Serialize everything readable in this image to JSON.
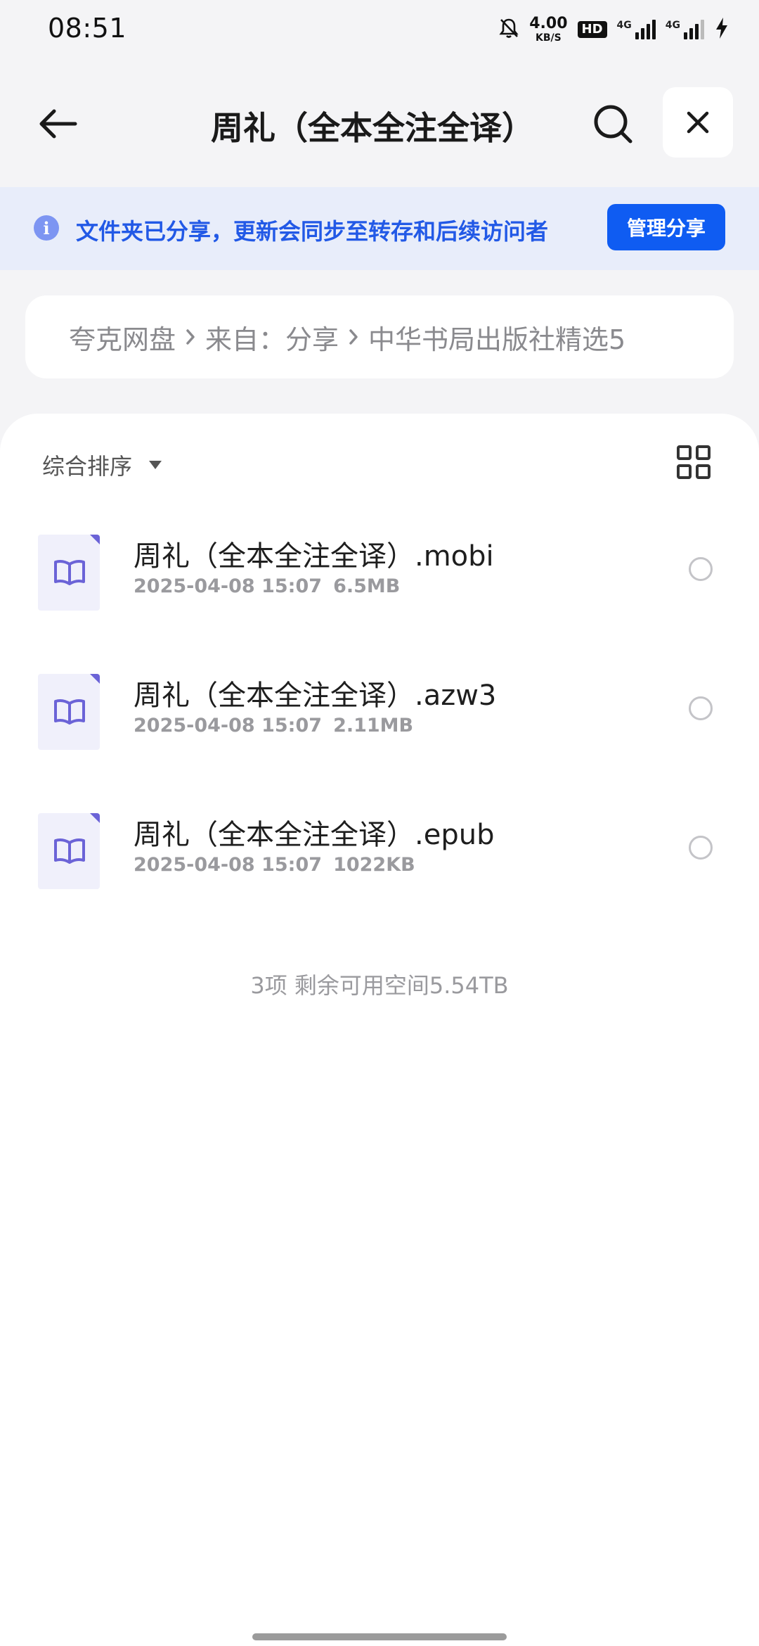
{
  "status_bar": {
    "time": "08:51",
    "net_speed_value": "4.00",
    "net_speed_unit": "KB/S",
    "hd_label": "HD",
    "signal_1_label": "4G",
    "signal_2_label": "4G",
    "icons": [
      "bell-off-icon",
      "battery-charging-icon"
    ]
  },
  "header": {
    "title": "周礼（全本全注全译）",
    "icons": [
      "back-arrow-icon",
      "search-icon",
      "close-icon"
    ]
  },
  "share_banner": {
    "text": "文件夹已分享，更新会同步至转存和后续访问者",
    "button_label": "管理分享",
    "accent_color": "#0f5cf2",
    "text_color": "#2259e6",
    "background_color": "#e8edfa"
  },
  "breadcrumb": {
    "items": [
      "夸克网盘",
      "来自：分享",
      "中华书局出版社精选5"
    ]
  },
  "toolbar": {
    "sort_label": "综合排序",
    "view_toggle_icon": "grid-view-icon"
  },
  "files": [
    {
      "name": "周礼（全本全注全译）.mobi",
      "date": "2025-04-08 15:07",
      "size": "6.5MB",
      "icon": "book-icon",
      "selected": false
    },
    {
      "name": "周礼（全本全注全译）.azw3",
      "date": "2025-04-08 15:07",
      "size": "2.11MB",
      "icon": "book-icon",
      "selected": false
    },
    {
      "name": "周礼（全本全注全译）.epub",
      "date": "2025-04-08 15:07",
      "size": "1022KB",
      "icon": "book-icon",
      "selected": false
    }
  ],
  "summary": {
    "text": "3项 剩余可用空间5.54TB"
  }
}
